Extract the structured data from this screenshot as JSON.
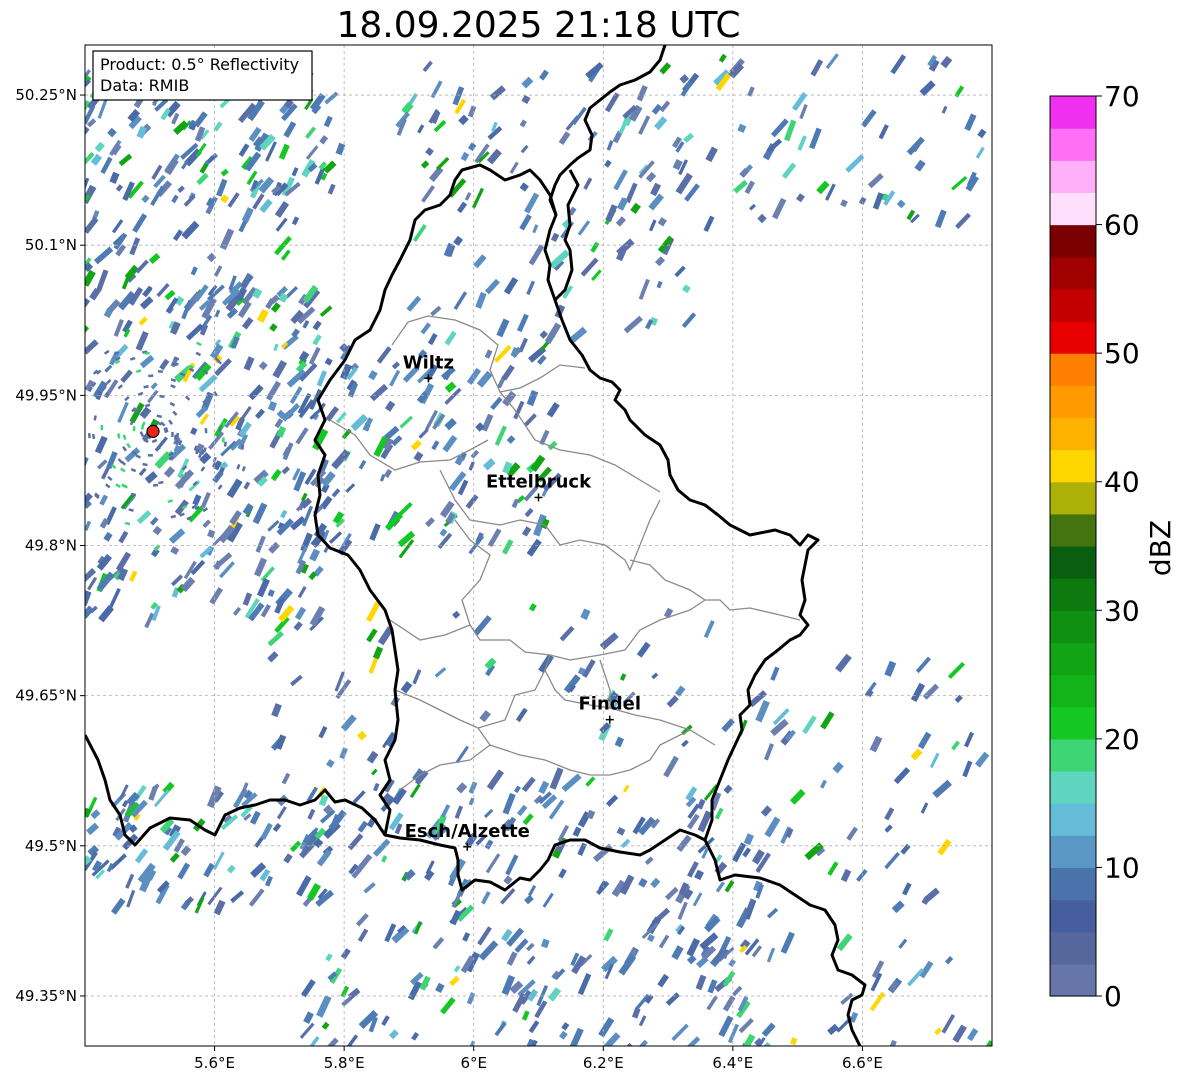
{
  "title": "18.09.2025 21:18 UTC",
  "info_box": {
    "product": "Product: 0.5° Reflectivity",
    "data": "Data: RMIB"
  },
  "axes": {
    "lon_range": [
      5.4,
      6.8
    ],
    "lat_range": [
      49.3,
      50.3
    ],
    "x_ticks": [
      "5.6°E",
      "5.8°E",
      "6°E",
      "6.2°E",
      "6.4°E",
      "6.6°E"
    ],
    "x_tick_values": [
      5.6,
      5.8,
      6.0,
      6.2,
      6.4,
      6.6
    ],
    "y_ticks": [
      "50.25°N",
      "50.1°N",
      "49.95°N",
      "49.8°N",
      "49.65°N",
      "49.5°N",
      "49.35°N"
    ],
    "y_tick_values": [
      50.25,
      50.1,
      49.95,
      49.8,
      49.65,
      49.5,
      49.35
    ],
    "grid": true
  },
  "cities": [
    {
      "name": "Wiltz",
      "lon": 5.93,
      "lat": 49.967
    },
    {
      "name": "Ettelbruck",
      "lon": 6.1,
      "lat": 49.848
    },
    {
      "name": "Findel",
      "lon": 6.21,
      "lat": 49.626
    },
    {
      "name": "Esch/Alzette",
      "lon": 5.99,
      "lat": 49.499
    }
  ],
  "radar_site": {
    "lon": 5.505,
    "lat": 49.914,
    "color": "#e8241c"
  },
  "colorbar": {
    "label": "dBZ",
    "min": 0,
    "max": 70,
    "tick_labels": [
      "0",
      "10",
      "20",
      "30",
      "40",
      "50",
      "60",
      "70"
    ],
    "tick_values": [
      0,
      10,
      20,
      30,
      40,
      50,
      60,
      70
    ],
    "colors": [
      "#6776a8",
      "#56679e",
      "#465ea0",
      "#4a73ac",
      "#5a97c4",
      "#64bcd8",
      "#5fd5c0",
      "#3ed576",
      "#13c823",
      "#13b41a",
      "#12a414",
      "#108f12",
      "#0d7a10",
      "#0a5e0f",
      "#44740f",
      "#adb006",
      "#ffd600",
      "#fdb200",
      "#ff9a00",
      "#ff7f00",
      "#e80000",
      "#c20000",
      "#a00000",
      "#7a0000",
      "#ffe0fc",
      "#ffb0f8",
      "#ff70f4",
      "#f030f0"
    ]
  }
}
